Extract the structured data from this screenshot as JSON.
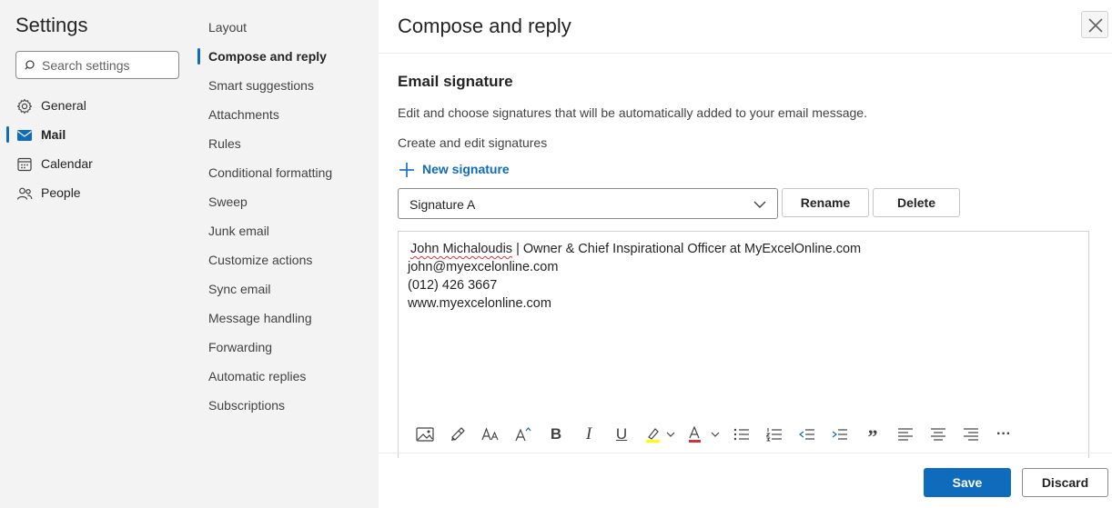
{
  "settings": {
    "title": "Settings",
    "search_placeholder": "Search settings",
    "nav": [
      {
        "label": "General",
        "icon": "gear-icon"
      },
      {
        "label": "Mail",
        "icon": "mail-icon",
        "active": true
      },
      {
        "label": "Calendar",
        "icon": "calendar-icon"
      },
      {
        "label": "People",
        "icon": "people-icon"
      }
    ]
  },
  "mail_subnav": [
    {
      "label": "Layout"
    },
    {
      "label": "Compose and reply",
      "active": true
    },
    {
      "label": "Smart suggestions"
    },
    {
      "label": "Attachments"
    },
    {
      "label": "Rules"
    },
    {
      "label": "Conditional formatting"
    },
    {
      "label": "Sweep"
    },
    {
      "label": "Junk email"
    },
    {
      "label": "Customize actions"
    },
    {
      "label": "Sync email"
    },
    {
      "label": "Message handling"
    },
    {
      "label": "Forwarding"
    },
    {
      "label": "Automatic replies"
    },
    {
      "label": "Subscriptions"
    }
  ],
  "panel": {
    "title": "Compose and reply",
    "section_title": "Email signature",
    "section_desc": "Edit and choose signatures that will be automatically added to your email message.",
    "create_label": "Create and edit signatures",
    "new_signature": "New signature",
    "selected_signature": "Signature A",
    "rename_label": "Rename",
    "delete_label": "Delete",
    "signature_lines": {
      "line1_name": "John Michaloudis",
      "line1_rest": " | Owner & Chief Inspirational Officer at MyExcelOnline.com",
      "line2": "john@myexcelonline.com",
      "line3": "(012) 426 3667",
      "line4": "www.myexcelonline.com"
    },
    "toolbar_icons": [
      "insert-picture-icon",
      "format-painter-icon",
      "font-icon",
      "font-size-icon",
      "bold-icon",
      "italic-icon",
      "underline-icon",
      "highlight-icon",
      "font-color-icon",
      "bullets-icon",
      "numbering-icon",
      "decrease-indent-icon",
      "increase-indent-icon",
      "quote-icon",
      "align-left-icon",
      "align-center-icon",
      "align-right-icon",
      "more-options-icon"
    ],
    "toolbar_glyphs": {
      "bold": "B",
      "italic": "I",
      "underline": "U",
      "quote": "”",
      "more": "···"
    },
    "save_label": "Save",
    "discard_label": "Discard"
  },
  "colors": {
    "accent": "#0f6cbd",
    "sidebar_bg": "#f3f3f3",
    "highlight": "#ffff00",
    "font_color": "#d13438"
  }
}
